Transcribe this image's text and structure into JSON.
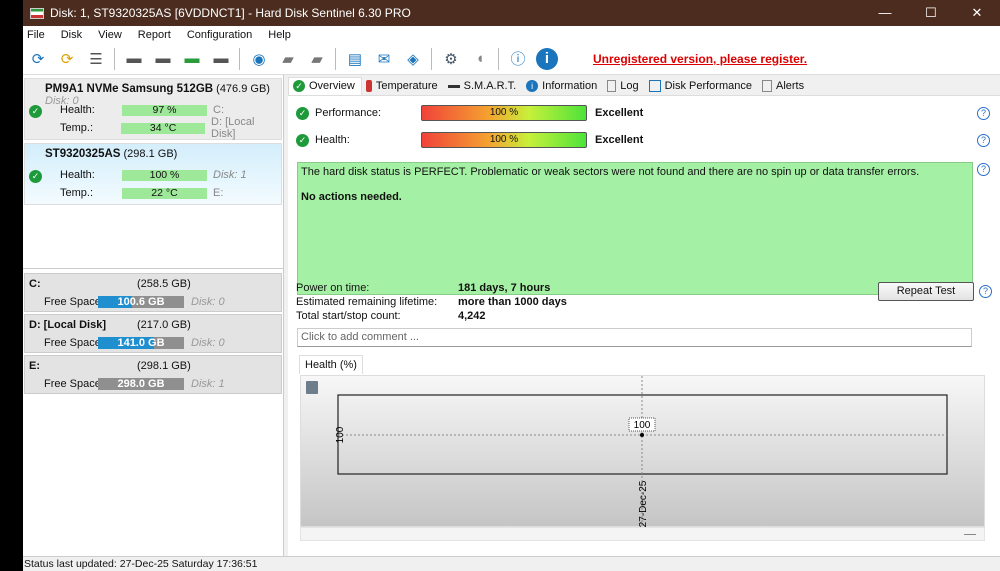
{
  "window": {
    "title": "Disk: 1, ST9320325AS [6VDDNCT1]  -  Hard Disk Sentinel 6.30 PRO",
    "controls": [
      "minimize",
      "maximize",
      "close"
    ]
  },
  "menu": [
    "File",
    "Disk",
    "View",
    "Report",
    "Configuration",
    "Help"
  ],
  "toolbar": {
    "icons": [
      "refresh-icon",
      "refresh-warning-icon",
      "disk-list-icon",
      "disk-settings-icon",
      "disk-schedule-icon",
      "disk-ok-icon",
      "disk-search-icon",
      "disk-network-icon",
      "disk-copy-icon",
      "disk-transfer-icon",
      "notes-icon",
      "mail-icon",
      "network-icon",
      "gear-icon",
      "speaker-icon",
      "help-icon",
      "info-icon"
    ],
    "register_link": "Unregistered version, please register."
  },
  "disks": [
    {
      "name": "PM9A1 NVMe Samsung 512GB",
      "size": "(476.9 GB)",
      "disk": "Disk: 0",
      "health": "97 %",
      "temp": "34 °C",
      "extra1": "C:",
      "extra2": "D: [Local Disk]"
    },
    {
      "name": "ST9320325AS",
      "size": "(298.1 GB)",
      "disk": "",
      "health": "100 %",
      "temp": "22 °C",
      "extra1": "Disk: 1",
      "extra2": "E:"
    }
  ],
  "labels": {
    "health": "Health:",
    "temp": "Temp.:",
    "free": "Free Space"
  },
  "volumes": [
    {
      "name": "C:",
      "size": "(258.5 GB)",
      "free": "100.6 GB",
      "disk": "Disk: 0",
      "free_fraction": 0.39
    },
    {
      "name": "D: [Local Disk]",
      "size": "(217.0 GB)",
      "free": "141.0 GB",
      "disk": "Disk: 0",
      "free_fraction": 0.65
    },
    {
      "name": "E:",
      "size": "(298.1 GB)",
      "free": "298.0 GB",
      "disk": "Disk: 1",
      "free_fraction": 0
    }
  ],
  "tabs": [
    "Overview",
    "Temperature",
    "S.M.A.R.T.",
    "Information",
    "Log",
    "Disk Performance",
    "Alerts"
  ],
  "overview": {
    "performance": {
      "label": "Performance:",
      "value": "100 %",
      "rating": "Excellent"
    },
    "health": {
      "label": "Health:",
      "value": "100 %",
      "rating": "Excellent"
    },
    "status_text": "The hard disk status is PERFECT. Problematic or weak sectors were not found and there are no spin up or data transfer errors.",
    "actions": "No actions needed.",
    "info": [
      {
        "k": "Power on time:",
        "v": "181 days, 7 hours"
      },
      {
        "k": "Estimated remaining lifetime:",
        "v": "more than 1000 days"
      },
      {
        "k": "Total start/stop count:",
        "v": "4,242"
      }
    ],
    "repeat_button": "Repeat Test",
    "comment_placeholder": "Click to add comment ...",
    "chart_tab": "Health (%)"
  },
  "chart_data": {
    "type": "line",
    "title": "Health (%)",
    "x": [
      "27-Dec-25"
    ],
    "values": [
      100
    ],
    "point_label": "100",
    "ytick": "100",
    "xtick": "27-Dec-25"
  },
  "statusbar": "Status last updated: 27-Dec-25 Saturday 17:36:51"
}
